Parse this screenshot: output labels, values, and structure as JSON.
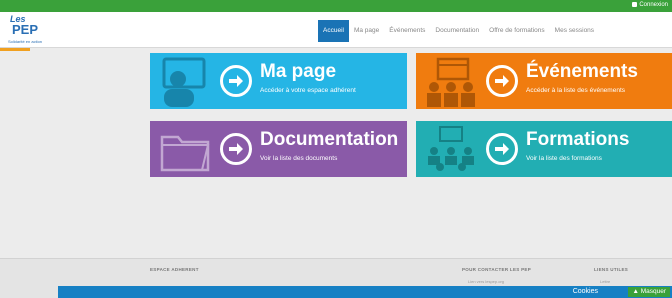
{
  "topbar": {
    "status_text": "Connexion"
  },
  "logo": {
    "line1": "Les",
    "line2": "PEP",
    "line3": "Solidarité en action"
  },
  "nav": {
    "items": [
      {
        "label": "Accueil",
        "active": true
      },
      {
        "label": "Ma page",
        "active": false
      },
      {
        "label": "Événements",
        "active": false
      },
      {
        "label": "Documentation",
        "active": false
      },
      {
        "label": "Offre de formations",
        "active": false
      },
      {
        "label": "Mes sessions",
        "active": false
      }
    ]
  },
  "tiles": [
    {
      "title": "Ma page",
      "subtitle": "Accéder à votre espace adhérent",
      "color": "#25b5e5"
    },
    {
      "title": "Événements",
      "subtitle": "Accéder à la liste des événements",
      "color": "#f07c0f"
    },
    {
      "title": "Documentation",
      "subtitle": "Voir la liste des documents",
      "color": "#8a5aa8"
    },
    {
      "title": "Formations",
      "subtitle": "Voir la liste des formations",
      "color": "#22aeb3"
    }
  ],
  "footer": {
    "col1_title": "ESPACE ADHERENT",
    "col2_title": "POUR CONTACTER LES PEP",
    "col2_line": "Lien vers lespep.org",
    "col3_title": "LIENS UTILES",
    "col3_line": "Lettre"
  },
  "popup": {
    "label": "Cookies",
    "button_label": "Masquer"
  }
}
